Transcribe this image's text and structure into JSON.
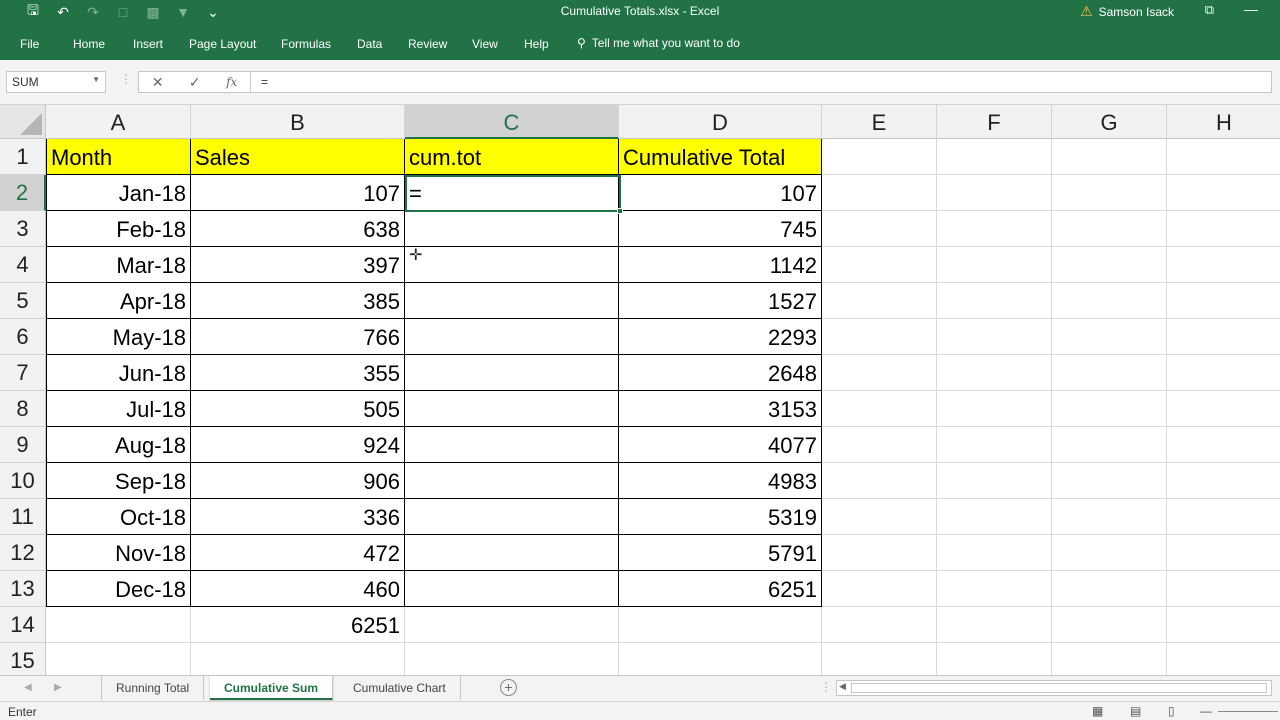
{
  "app": {
    "doc_title": "Cumulative Totals.xlsx  -  Excel",
    "user_name": "Samson Isack"
  },
  "ribbon": {
    "tabs": [
      "File",
      "Home",
      "Insert",
      "Page Layout",
      "Formulas",
      "Data",
      "Review",
      "View",
      "Help"
    ],
    "tell_me": "Tell me what you want to do"
  },
  "formula_bar": {
    "name_box": "SUM",
    "fx_label": "fx",
    "formula": "="
  },
  "columns": [
    "A",
    "B",
    "C",
    "D",
    "E",
    "F",
    "G",
    "H"
  ],
  "active_column": "C",
  "active_row": "2",
  "rows": [
    "1",
    "2",
    "3",
    "4",
    "5",
    "6",
    "7",
    "8",
    "9",
    "10",
    "11",
    "12",
    "13",
    "14",
    "15"
  ],
  "headers": {
    "a": "Month",
    "b": "Sales",
    "c": "cum.tot",
    "d": "Cumulative Total"
  },
  "data_rows": [
    {
      "month": "Jan-18",
      "sales": "107",
      "cum": "=",
      "total": "107"
    },
    {
      "month": "Feb-18",
      "sales": "638",
      "cum": "",
      "total": "745"
    },
    {
      "month": "Mar-18",
      "sales": "397",
      "cum": "",
      "total": "1142"
    },
    {
      "month": "Apr-18",
      "sales": "385",
      "cum": "",
      "total": "1527"
    },
    {
      "month": "May-18",
      "sales": "766",
      "cum": "",
      "total": "2293"
    },
    {
      "month": "Jun-18",
      "sales": "355",
      "cum": "",
      "total": "2648"
    },
    {
      "month": "Jul-18",
      "sales": "505",
      "cum": "",
      "total": "3153"
    },
    {
      "month": "Aug-18",
      "sales": "924",
      "cum": "",
      "total": "4077"
    },
    {
      "month": "Sep-18",
      "sales": "906",
      "cum": "",
      "total": "4983"
    },
    {
      "month": "Oct-18",
      "sales": "336",
      "cum": "",
      "total": "5319"
    },
    {
      "month": "Nov-18",
      "sales": "472",
      "cum": "",
      "total": "5791"
    },
    {
      "month": "Dec-18",
      "sales": "460",
      "cum": "",
      "total": "6251"
    }
  ],
  "sum_row": {
    "sales": "6251"
  },
  "sheets": [
    "Running Total",
    "Cumulative Sum",
    "Cumulative Chart"
  ],
  "active_sheet": "Cumulative Sum",
  "status": {
    "mode": "Enter"
  },
  "colors": {
    "excel_green": "#217346",
    "header_yellow": "#ffff00"
  },
  "icons": [
    "save-icon",
    "undo-icon",
    "redo-icon",
    "new-file-icon",
    "chart-icon",
    "filter-icon",
    "customize-qat-icon",
    "warning-icon",
    "restore-icon",
    "minimize-icon",
    "search-icon",
    "cancel-icon",
    "enter-icon",
    "move-cursor-icon",
    "add-sheet-icon"
  ]
}
